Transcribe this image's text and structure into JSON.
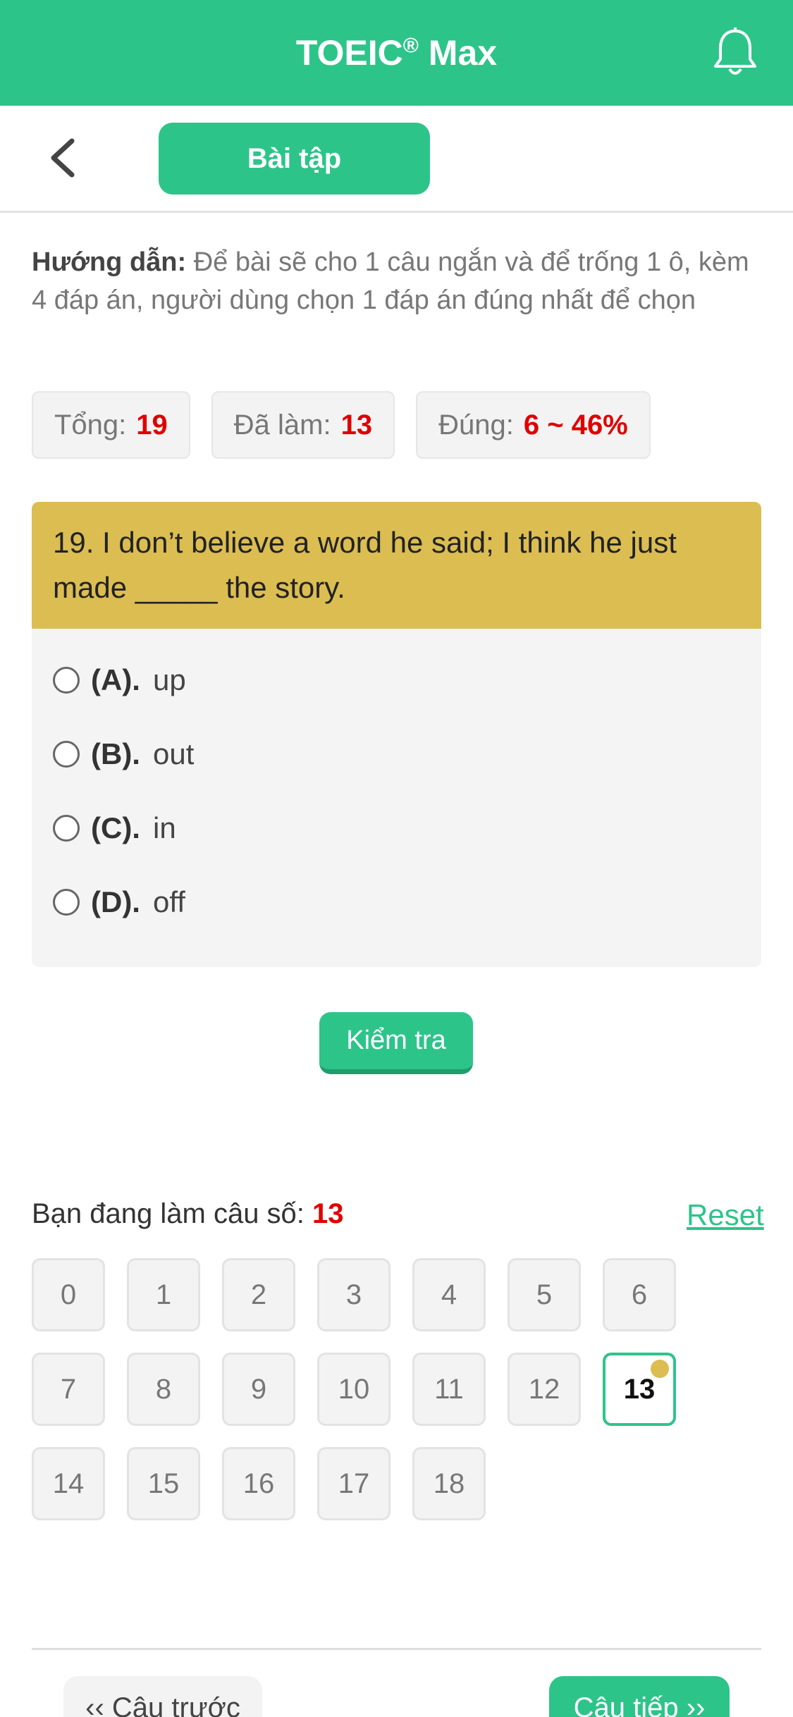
{
  "header": {
    "title": "TOEIC",
    "title_mark": "®",
    "title_suffix": " Max",
    "bell_icon": "bell-icon"
  },
  "nav": {
    "back_icon": "chevron-left-icon",
    "tab_label": "Bài tập"
  },
  "instructions": {
    "label": "Hướng dẫn:",
    "text": " Để bài sẽ cho 1 câu ngắn và để trống 1 ô, kèm 4 đáp án, người dùng chọn 1 đáp án đúng nhất để chọn"
  },
  "stats": {
    "total_label": "Tổng:",
    "total_value": "19",
    "done_label": "Đã làm:",
    "done_value": "13",
    "correct_label": "Đúng:",
    "correct_value": "6 ~ 46%"
  },
  "question": {
    "text": "19. I don’t believe a word he said; I think he just made _____ the story.",
    "options": [
      {
        "key": "(A).",
        "text": "up"
      },
      {
        "key": "(B).",
        "text": "out"
      },
      {
        "key": "(C).",
        "text": "in"
      },
      {
        "key": "(D).",
        "text": "off"
      }
    ]
  },
  "check_label": "Kiểm tra",
  "progress": {
    "label": "Bạn đang làm câu số: ",
    "current": "13",
    "reset_label": "Reset",
    "numbers": [
      "0",
      "1",
      "2",
      "3",
      "4",
      "5",
      "6",
      "7",
      "8",
      "9",
      "10",
      "11",
      "12",
      "13",
      "14",
      "15",
      "16",
      "17",
      "18"
    ]
  },
  "footer": {
    "prev_label": "‹‹ Câu trước",
    "next_label": "Câu tiếp ››"
  },
  "colors": {
    "primary": "#2dc48a",
    "question_bg": "#dbbd52",
    "highlight": "#e00000"
  }
}
